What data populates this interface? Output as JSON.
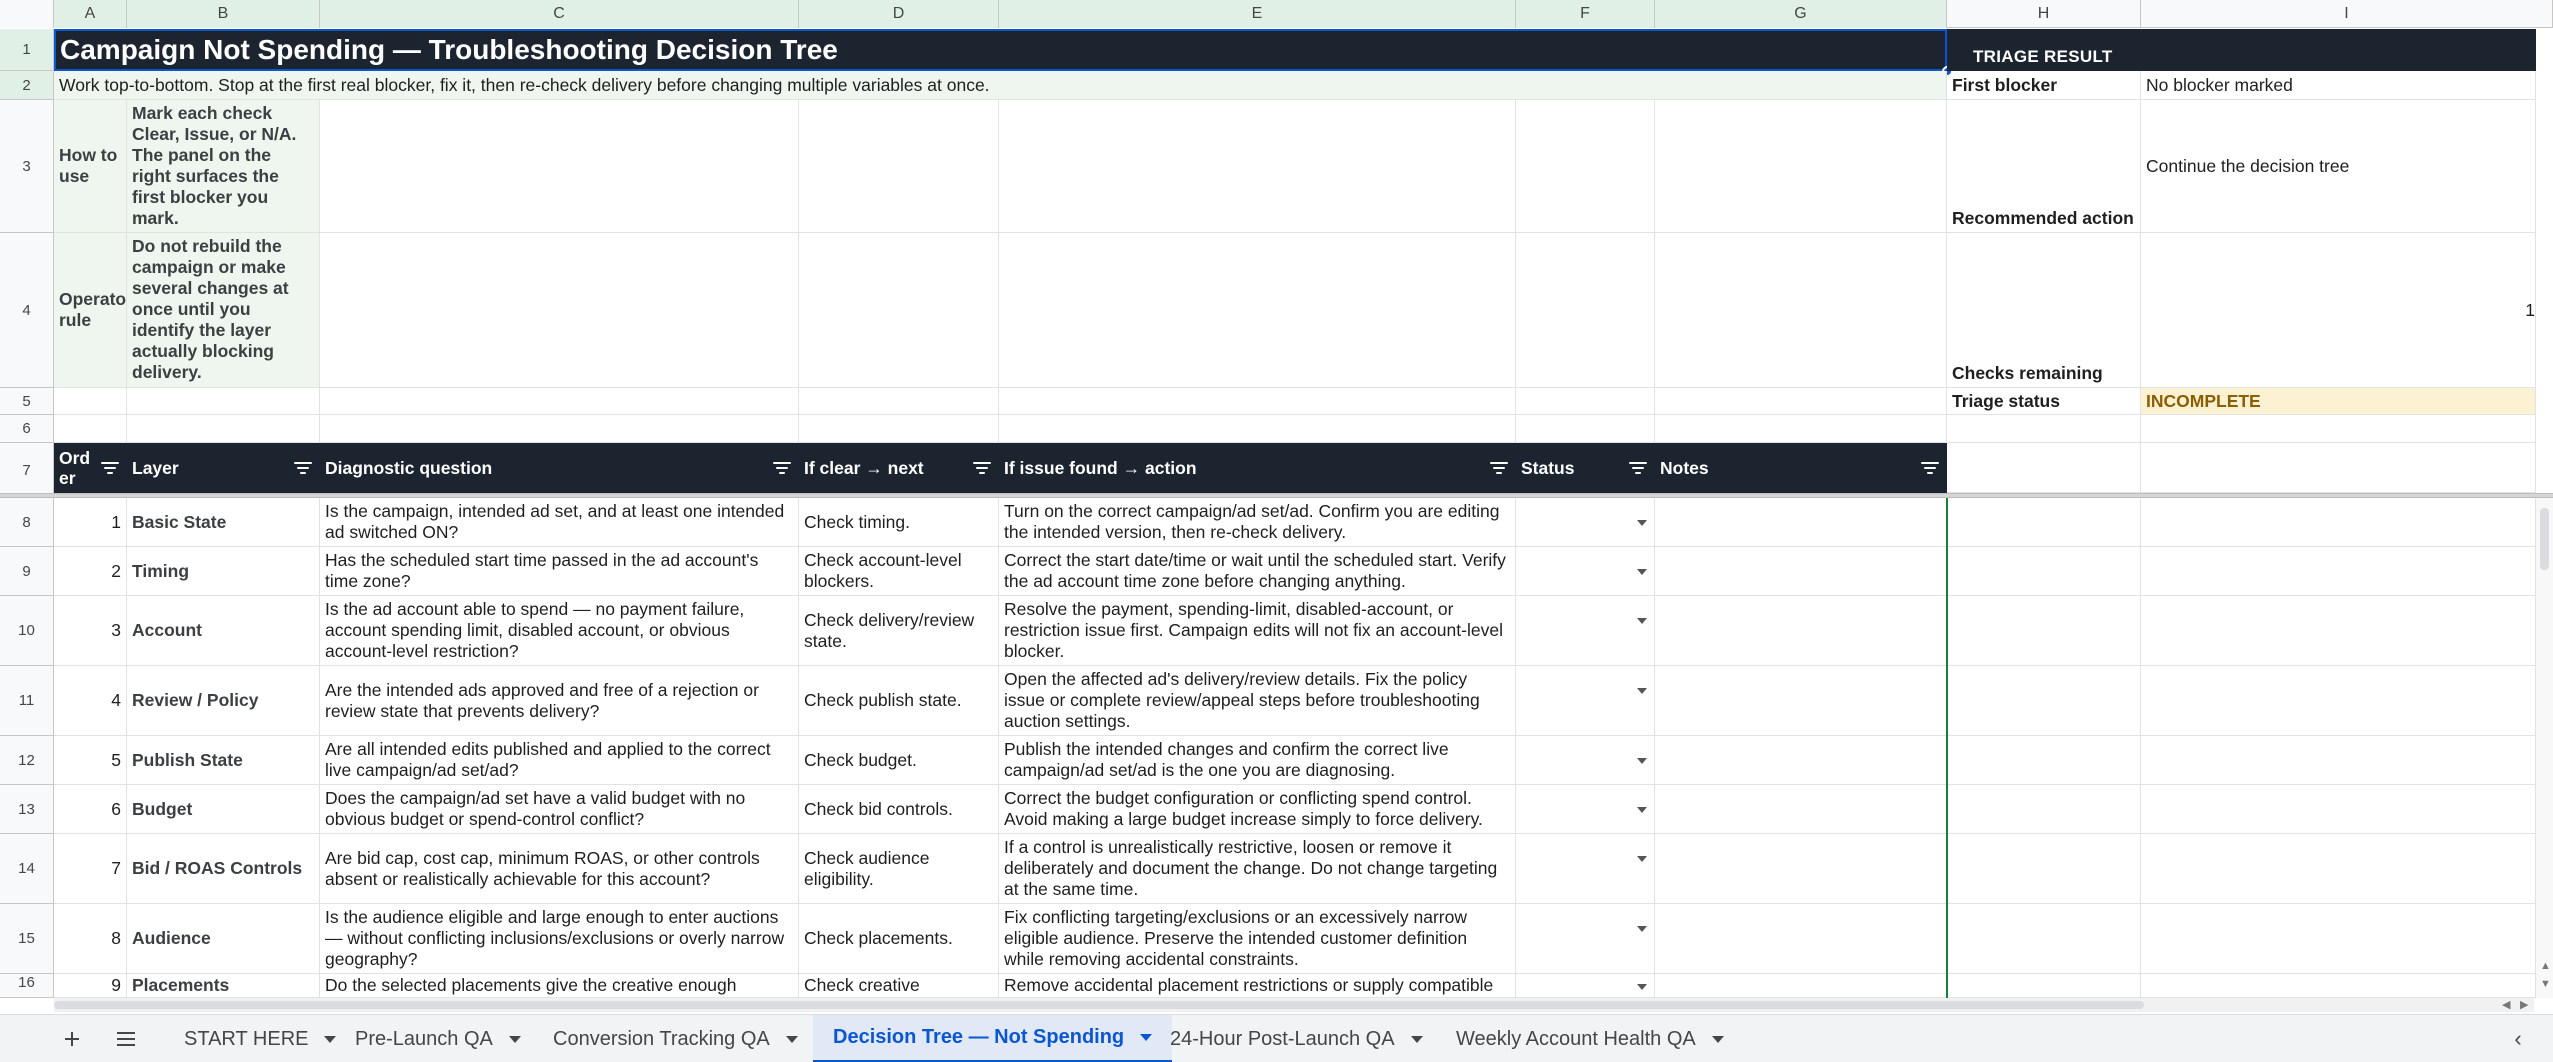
{
  "columns": [
    "A",
    "B",
    "C",
    "D",
    "E",
    "F",
    "G",
    "H",
    "I"
  ],
  "row_numbers": [
    "1",
    "2",
    "3",
    "4",
    "5",
    "6",
    "7",
    "8",
    "9",
    "10",
    "11",
    "12",
    "13",
    "14",
    "15",
    "16"
  ],
  "title": "Campaign Not Spending — Troubleshooting Decision Tree",
  "subtitle": "Work top-to-bottom. Stop at the first real blocker, fix it, then re-check delivery before changing multiple variables at once.",
  "how_to_use": {
    "label": "How to use",
    "text": "Mark each check Clear, Issue, or N/A. The panel on the right surfaces the first blocker you mark."
  },
  "operator_rule": {
    "label": "Operator rule",
    "text": "Do not rebuild the campaign or make several changes at once until you identify the layer actually blocking delivery."
  },
  "triage": {
    "heading": "TRIAGE RESULT",
    "first_blocker_label": "First blocker",
    "first_blocker_value": "No blocker marked",
    "recommended_label": "Recommended action",
    "recommended_value": "Continue the decision tree",
    "checks_remaining_label": "Checks remaining",
    "checks_remaining_value": "1",
    "status_label": "Triage status",
    "status_value": "INCOMPLETE"
  },
  "table_headers": {
    "order": "Order",
    "layer": "Layer",
    "question": "Diagnostic question",
    "clear_next": "If clear → next",
    "issue_action": "If issue found → action",
    "status": "Status",
    "notes": "Notes"
  },
  "rows": [
    {
      "order": "1",
      "layer": "Basic State",
      "question": "Is the campaign, intended ad set, and at least one intended ad switched ON?",
      "next": "Check timing.",
      "action": "Turn on the correct campaign/ad set/ad. Confirm you are editing the intended version, then re-check delivery."
    },
    {
      "order": "2",
      "layer": "Timing",
      "question": "Has the scheduled start time passed in the ad account's time zone?",
      "next": "Check account-level blockers.",
      "action": "Correct the start date/time or wait until the scheduled start. Verify the ad account time zone before changing anything."
    },
    {
      "order": "3",
      "layer": "Account",
      "question": "Is the ad account able to spend — no payment failure, account spending limit, disabled account, or obvious account-level restriction?",
      "next": "Check delivery/review state.",
      "action": "Resolve the payment, spending-limit, disabled-account, or restriction issue first. Campaign edits will not fix an account-level blocker."
    },
    {
      "order": "4",
      "layer": "Review / Policy",
      "question": "Are the intended ads approved and free of a rejection or review state that prevents delivery?",
      "next": "Check publish state.",
      "action": "Open the affected ad's delivery/review details. Fix the policy issue or complete review/appeal steps before troubleshooting auction settings."
    },
    {
      "order": "5",
      "layer": "Publish State",
      "question": "Are all intended edits published and applied to the correct live campaign/ad set/ad?",
      "next": "Check budget.",
      "action": "Publish the intended changes and confirm the correct live campaign/ad set/ad is the one you are diagnosing."
    },
    {
      "order": "6",
      "layer": "Budget",
      "question": "Does the campaign/ad set have a valid budget with no obvious budget or spend-control conflict?",
      "next": "Check bid controls.",
      "action": "Correct the budget configuration or conflicting spend control. Avoid making a large budget increase simply to force delivery."
    },
    {
      "order": "7",
      "layer": "Bid / ROAS Controls",
      "question": "Are bid cap, cost cap, minimum ROAS, or other controls absent or realistically achievable for this account?",
      "next": "Check audience eligibility.",
      "action": "If a control is unrealistically restrictive, loosen or remove it deliberately and document the change. Do not change targeting at the same time."
    },
    {
      "order": "8",
      "layer": "Audience",
      "question": "Is the audience eligible and large enough to enter auctions — without conflicting inclusions/exclusions or overly narrow geography?",
      "next": "Check placements.",
      "action": "Fix conflicting targeting/exclusions or an excessively narrow eligible audience. Preserve the intended customer definition while removing accidental constraints."
    },
    {
      "order": "9",
      "layer": "Placements",
      "question": "Do the selected placements give the creative enough",
      "next": "Check creative eligibility.",
      "action": "Remove accidental placement restrictions or supply compatible"
    }
  ],
  "sheet_tabs": [
    {
      "label": "START HERE",
      "active": false
    },
    {
      "label": "Pre-Launch QA",
      "active": false
    },
    {
      "label": "Conversion Tracking QA",
      "active": false
    },
    {
      "label": "Decision Tree — Not Spending",
      "active": true
    },
    {
      "label": "24-Hour Post-Launch QA",
      "active": false
    },
    {
      "label": "Weekly Account Health QA",
      "active": false
    }
  ],
  "colors": {
    "header_dark": "#1c2430",
    "band_green": "#eef6ef",
    "status_incomplete_bg": "#fdf1d4",
    "status_incomplete_text": "#8b5e00",
    "active_tab": "#0b57d0"
  }
}
